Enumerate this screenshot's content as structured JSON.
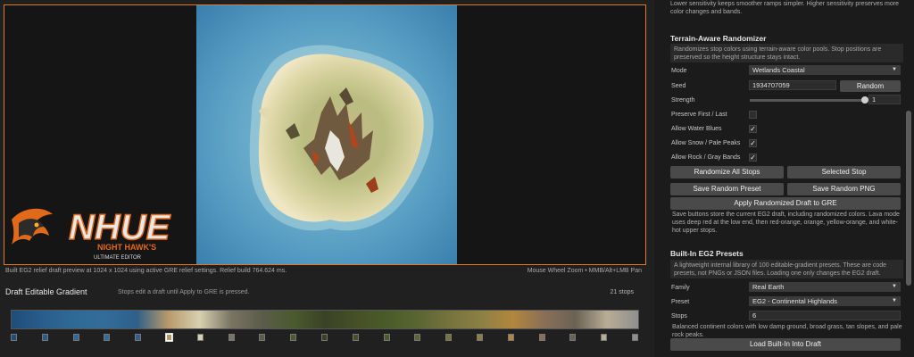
{
  "preview": {
    "status_left": "Built EG2 relief draft preview at 1024 x 1024 using active GRE relief settings. Relief build 764.624 ms.",
    "status_right": "Mouse Wheel Zoom  •  MMB/Alt+LMB Pan"
  },
  "logo": {
    "text": "NHUE",
    "sub1": "NIGHT HAWK'S",
    "sub2": "ULTIMATE EDITOR"
  },
  "gradient": {
    "title": "Draft Editable Gradient",
    "hint": "Stops edit a draft until Apply to GRE is pressed.",
    "count": "21 stops"
  },
  "stop_colors": [
    "#1f4d78",
    "#2a5d8c",
    "#2f6a97",
    "#336c99",
    "#2f5f8a",
    "#b89a6a",
    "#d8d0b0",
    "#7a7464",
    "#5b5c4a",
    "#4b5a2f",
    "#3a4226",
    "#465026",
    "#4a5c2a",
    "#5a6633",
    "#77733d",
    "#8c8045",
    "#b2863e",
    "#8a6f56",
    "#6b6255",
    "#b8ad96",
    "#8f8f8f"
  ],
  "sidebar": {
    "sens_text": "Lower sensitivity keeps smoother ramps simpler. Higher sensitivity preserves more color changes and bands.",
    "rand_title": "Terrain-Aware Randomizer",
    "rand_desc": "Randomizes stop colors using terrain-aware color pools. Stop positions are preserved so the height structure stays intact.",
    "mode_label": "Mode",
    "mode_value": "Wetlands Coastal",
    "seed_label": "Seed",
    "seed_value": "1934707059",
    "random_btn": "Random",
    "strength_label": "Strength",
    "strength_value": "1",
    "preserve_label": "Preserve First / Last",
    "water_label": "Allow Water Blues",
    "snow_label": "Allow Snow / Pale Peaks",
    "rock_label": "Allow Rock / Gray Bands",
    "randomize_all_btn": "Randomize All Stops",
    "selected_stop_btn": "Selected Stop",
    "save_preset_btn": "Save Random Preset",
    "save_png_btn": "Save Random PNG",
    "apply_btn": "Apply Randomized Draft to GRE",
    "save_note": "Save buttons store the current EG2 draft, including randomized colors. Lava mode uses deep red at the low end, then red-orange, orange, yellow-orange, and white-hot upper stops.",
    "presets_title": "Built-In EG2 Presets",
    "presets_desc": "A lightweight internal library of 100 editable-gradient presets. These are code presets, not PNGs or JSON files. Loading one only changes the EG2 draft.",
    "family_label": "Family",
    "family_value": "Real Earth",
    "preset_label": "Preset",
    "preset_value": "EG2 - Continental Highlands",
    "stops_label": "Stops",
    "stops_value": "6",
    "preset_note": "Balanced continent colors with low damp ground, broad grass, tan slopes, and pale rock peaks.",
    "load_btn": "Load Built-In Into Draft"
  }
}
